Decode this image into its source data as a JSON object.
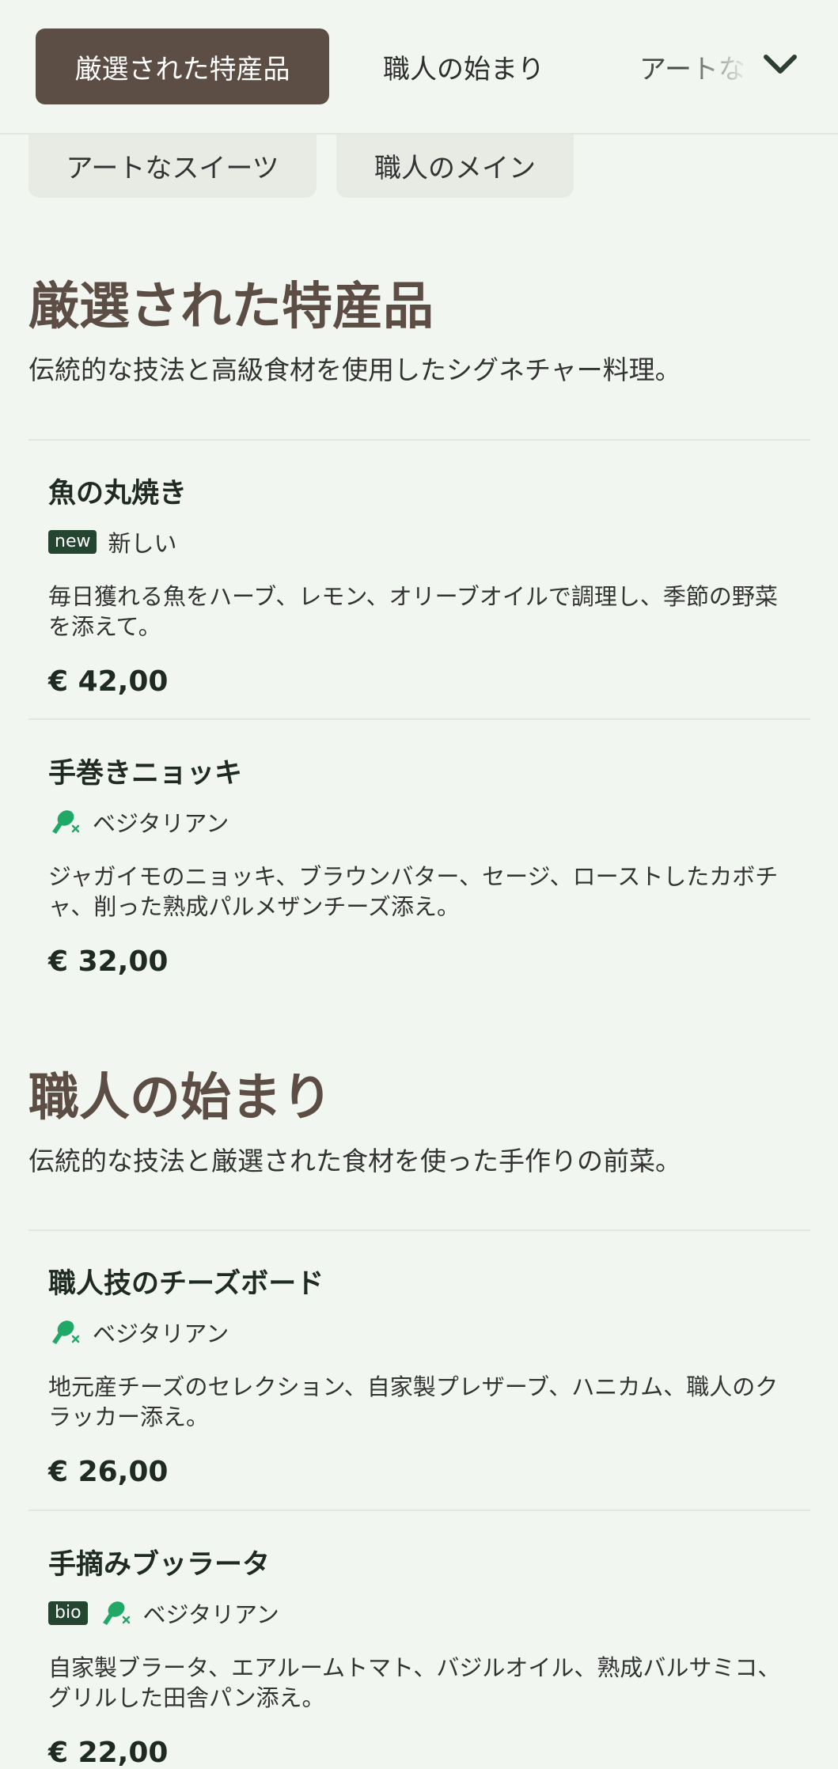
{
  "nav": {
    "tabs": [
      {
        "label": "厳選された特産品",
        "active": true
      },
      {
        "label": "職人の始まり",
        "active": false
      },
      {
        "label": "アートなスイーツ",
        "active": false
      }
    ],
    "more_icon": "chevron-down-icon"
  },
  "chips": [
    {
      "label": "アートなスイーツ"
    },
    {
      "label": "職人のメイン"
    }
  ],
  "sections": [
    {
      "title": "厳選された特産品",
      "description": "伝統的な技法と高級食材を使用したシグネチャー料理。",
      "items": [
        {
          "name": "魚の丸焼き",
          "badge": "new",
          "tag_label": "新しい",
          "description": "毎日獲れる魚をハーブ、レモン、オリーブオイルで調理し、季節の野菜を添えて。",
          "price": "€ 42,00"
        },
        {
          "name": "手巻きニョッキ",
          "tag_label": "ベジタリアン",
          "tag_icon": "vegetarian-icon",
          "description": "ジャガイモのニョッキ、ブラウンバター、セージ、ローストしたカボチャ、削った熟成パルメザンチーズ添え。",
          "price": "€ 32,00"
        }
      ]
    },
    {
      "title": "職人の始まり",
      "description": "伝統的な技法と厳選された食材を使った手作りの前菜。",
      "items": [
        {
          "name": "職人技のチーズボード",
          "tag_label": "ベジタリアン",
          "tag_icon": "vegetarian-icon",
          "description": "地元産チーズのセレクション、自家製プレザーブ、ハニカム、職人のクラッカー添え。",
          "price": "€ 26,00"
        },
        {
          "name": "手摘みブッラータ",
          "badge": "bio",
          "tag_label": "ベジタリアン",
          "tag_icon": "vegetarian-icon",
          "description": "自家製ブラータ、エアルームトマト、バジルオイル、熟成バルサミコ、グリルした田舎パン添え。",
          "price": "€ 22,00"
        }
      ]
    }
  ],
  "colors": {
    "background": "#f2f6f1",
    "accent_brown": "#5c4d45",
    "badge_green": "#24452f",
    "veg_icon_green": "#1fa866"
  }
}
